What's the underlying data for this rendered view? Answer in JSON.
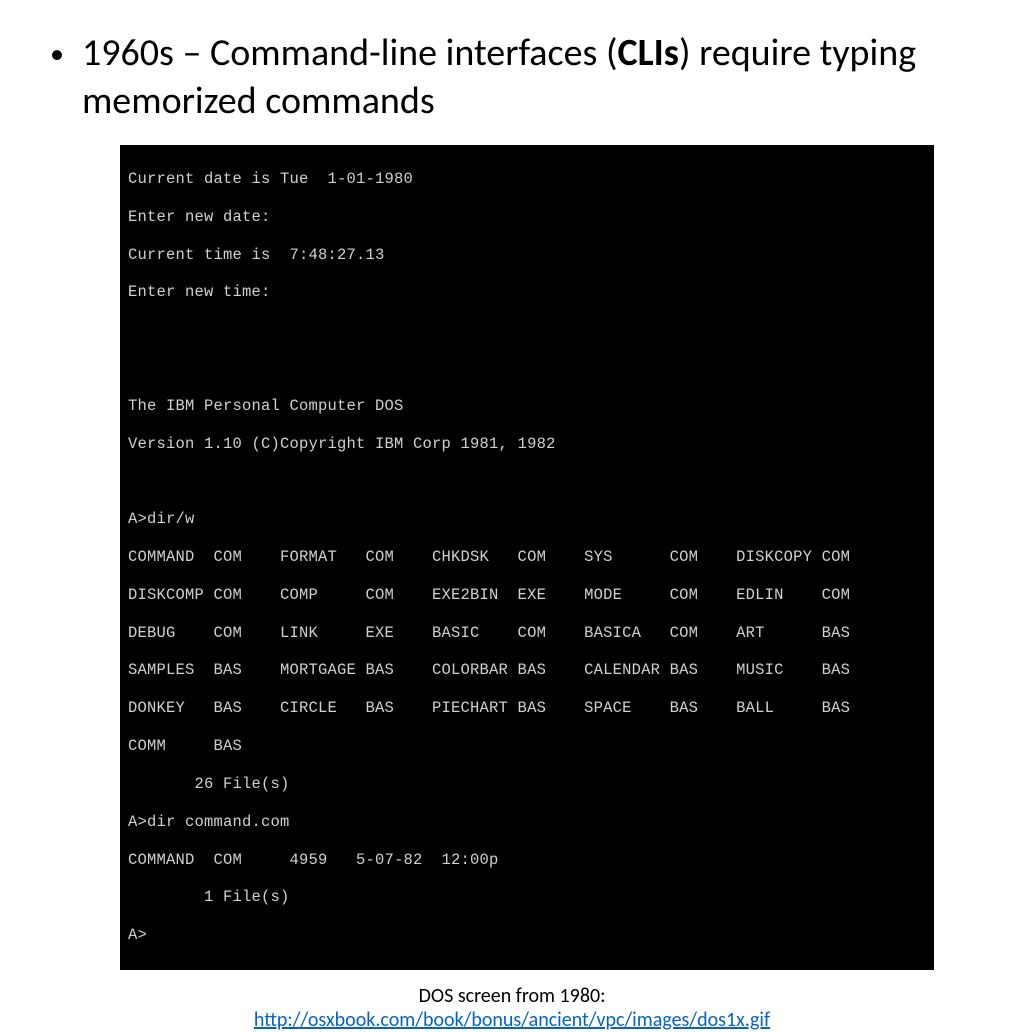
{
  "bullet": {
    "prefix": "1960s – Command-line interfaces (",
    "bold": "CLIs",
    "suffix": ") require typing memorized commands"
  },
  "terminal": {
    "l1": "Current date is Tue  1-01-1980",
    "l2": "Enter new date:",
    "l3": "Current time is  7:48:27.13",
    "l4": "Enter new time:",
    "blank1": " ",
    "blank2": " ",
    "l5": "The IBM Personal Computer DOS",
    "l6": "Version 1.10 (C)Copyright IBM Corp 1981, 1982",
    "blank3": " ",
    "l7": "A>dir/w",
    "row1": "COMMAND  COM    FORMAT   COM    CHKDSK   COM    SYS      COM    DISKCOPY COM",
    "row2": "DISKCOMP COM    COMP     COM    EXE2BIN  EXE    MODE     COM    EDLIN    COM",
    "row3": "DEBUG    COM    LINK     EXE    BASIC    COM    BASICA   COM    ART      BAS",
    "row4": "SAMPLES  BAS    MORTGAGE BAS    COLORBAR BAS    CALENDAR BAS    MUSIC    BAS",
    "row5": "DONKEY   BAS    CIRCLE   BAS    PIECHART BAS    SPACE    BAS    BALL     BAS",
    "row6": "COMM     BAS",
    "l8": "       26 File(s)",
    "l9": "A>dir command.com",
    "l10": "COMMAND  COM     4959   5-07-82  12:00p",
    "l11": "        1 File(s)",
    "l12": "A>"
  },
  "caption": {
    "text": "DOS screen from 1980:",
    "link": "http://osxbook.com/book/bonus/ancient/vpc/images/dos1x.gif"
  }
}
